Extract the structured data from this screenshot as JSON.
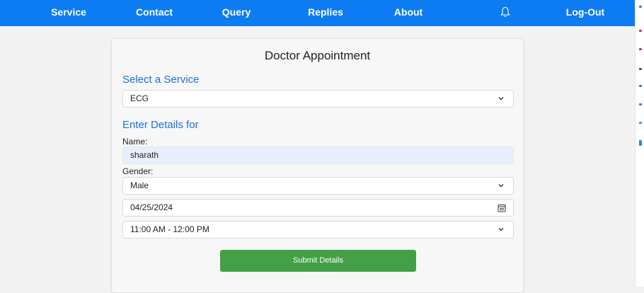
{
  "nav": {
    "items": [
      {
        "label": "Service"
      },
      {
        "label": "Contact"
      },
      {
        "label": "Query"
      },
      {
        "label": "Replies"
      },
      {
        "label": "About"
      },
      {
        "label": "Log-Out"
      }
    ],
    "bell_icon": "bell-icon"
  },
  "colors": {
    "navbar": "#0d7cf2",
    "heading": "#1c6fd8",
    "submit": "#43a047",
    "filled_input": "#e8eefb"
  },
  "form": {
    "title": "Doctor Appointment",
    "service_heading": "Select a Service",
    "service_value": "ECG",
    "details_heading": "Enter Details for",
    "name_label": "Name:",
    "name_value": "sharath",
    "gender_label": "Gender:",
    "gender_value": "Male",
    "date_value": "04/25/2024",
    "time_value": "11:00 AM - 12:00 PM",
    "submit_label": "Submit Details"
  }
}
